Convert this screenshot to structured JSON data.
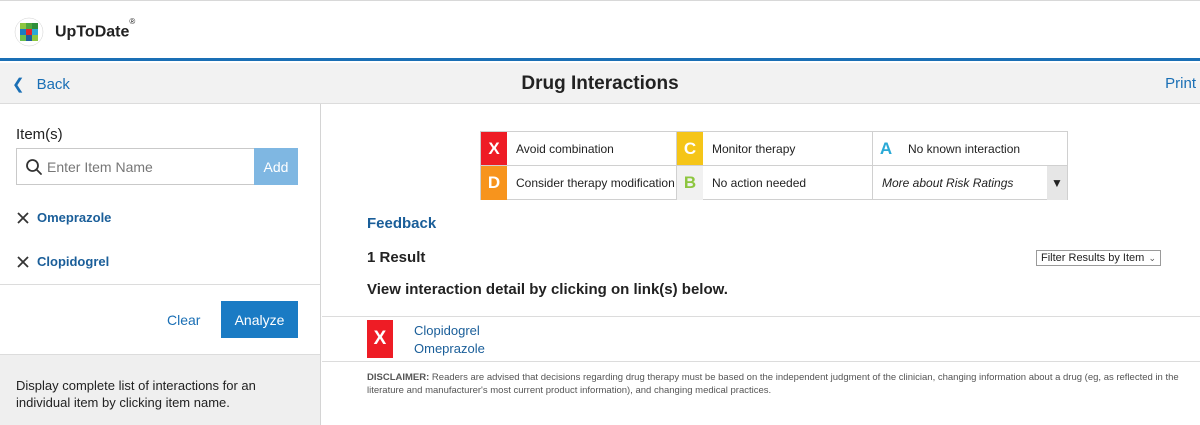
{
  "brand": {
    "name": "UpToDate",
    "mark": "®"
  },
  "header": {
    "back_label": "Back",
    "title": "Drug Interactions",
    "print_label": "Print"
  },
  "sidebar": {
    "items_label": "Item(s)",
    "search": {
      "placeholder": "Enter Item Name",
      "value": ""
    },
    "add_label": "Add",
    "items": [
      {
        "name": "Omeprazole"
      },
      {
        "name": "Clopidogrel"
      }
    ],
    "clear_label": "Clear",
    "analyze_label": "Analyze",
    "info_text": "Display complete list of interactions for an individual item by clicking item name."
  },
  "legend": {
    "ratings": [
      {
        "code": "X",
        "label": "Avoid combination",
        "color": "#ee1c25"
      },
      {
        "code": "C",
        "label": "Monitor therapy",
        "color": "#f5c518"
      },
      {
        "code": "A",
        "label": "No known interaction",
        "color": "#2aa9d6"
      },
      {
        "code": "D",
        "label": "Consider therapy modification",
        "color": "#f7941d"
      },
      {
        "code": "B",
        "label": "No action needed",
        "color": "#8dc63f"
      }
    ],
    "more_label": "More about Risk Ratings",
    "more_arrow": "▼"
  },
  "main": {
    "feedback_label": "Feedback",
    "result_count": "1 Result",
    "filter_label": "Filter Results by Item",
    "instruction": "View interaction detail by clicking on link(s) below.",
    "results": [
      {
        "rating": "X",
        "drug_1": "Clopidogrel",
        "drug_2": "Omeprazole"
      }
    ],
    "disclaimer_label": "DISCLAIMER:",
    "disclaimer_text": "Readers are advised that decisions regarding drug therapy must be based on the independent judgment of the clinician, changing information about a drug (eg, as reflected in the literature and manufacturer's most current product information), and changing medical practices."
  },
  "icons": {
    "logo": "uptodate-logo-icon",
    "back": "chevron-left-icon",
    "search": "search-icon",
    "remove": "close-icon",
    "filter": "chevron-down-icon"
  }
}
